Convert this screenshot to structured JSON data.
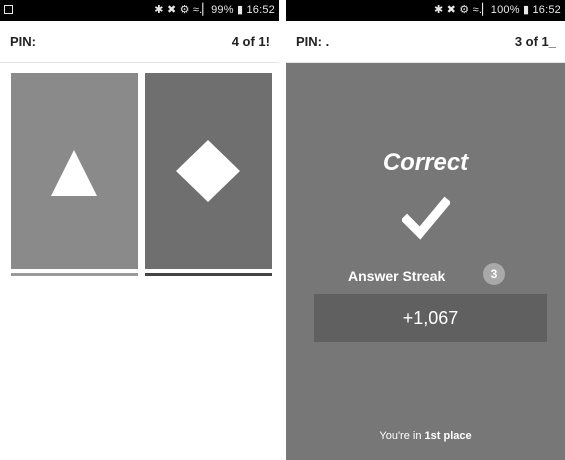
{
  "left_screen": {
    "status_bar": {
      "text": "✱ ✖ ⚙ ≈.▏99% ▮ 16:52"
    },
    "header": {
      "pin_label": "PIN:",
      "progress": "4 of 1!"
    },
    "tiles": [
      {
        "shape": "triangle-icon",
        "color": "#8a8a8a"
      },
      {
        "shape": "diamond-icon",
        "color": "#6f6f6f"
      }
    ]
  },
  "right_screen": {
    "status_bar": {
      "text": "✱ ✖ ⚙ ≈.▏100% ▮ 16:52"
    },
    "header": {
      "pin_label": "PIN: .",
      "progress": "3 of 1_"
    },
    "result": {
      "title": "Correct",
      "icon": "checkmark-icon",
      "streak_label": "Answer Streak",
      "streak_count": "3",
      "points": "+1,067",
      "place_prefix": "You're in ",
      "place_value": "1st place"
    }
  },
  "colors": {
    "status_bar": "#000000",
    "panel": "#777777",
    "points_box": "#606060"
  }
}
